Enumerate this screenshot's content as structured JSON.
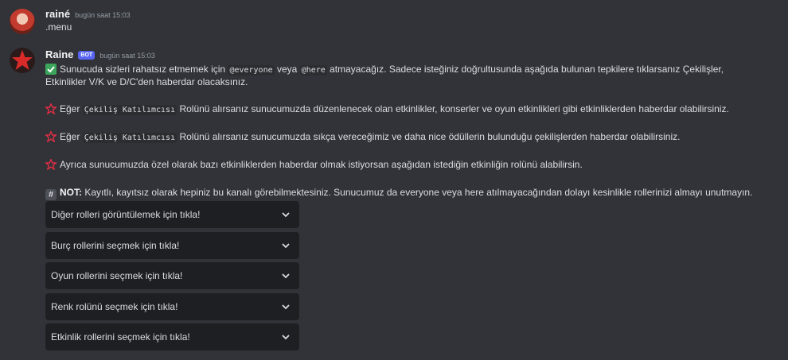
{
  "message1": {
    "author": "rainé",
    "timestamp": "bugün saat 15:03",
    "text": ".menu"
  },
  "message2": {
    "author": "Raine",
    "bot_tag": "BOT",
    "timestamp": "bugün saat 15:03",
    "line1_part1": "Sunucuda sizleri rahatsız etmemek için",
    "everyone": "@everyone",
    "line1_part2": "veya",
    "here": "@here",
    "line1_part3": "atmayacağız. Sadece isteğiniz doğrultusunda aşağıda bulunan tepkilere tıklarsanız Çekilişler,",
    "line2": "Etkinlikler V/K ve D/C'den haberdar olacaksınız.",
    "p1_part1": "Eğer",
    "p1_code": "Çekiliş Katılımcısı",
    "p1_part2": "Rolünü alırsanız sunucumuzda düzenlenecek olan etkinlikler, konserler ve oyun etkinlikleri gibi etkinliklerden haberdar olabilirsiniz.",
    "p2_part1": "Eğer",
    "p2_code": "Çekiliş Katılımcısı",
    "p2_part2": "Rolünü alırsanız sunucumuzda sıkça vereceğimiz  ve daha nice ödüllerin bulunduğu çekilişlerden haberdar olabilirsiniz.",
    "p3": "Ayrıca sunucumuzda özel olarak bazı etkinliklerden haberdar olmak istiyorsan aşağıdan istediğin etkinliğin rolünü alabilirsin.",
    "note_label": "NOT:",
    "note_text": "Kayıtlı, kayıtsız olarak hepiniz bu kanalı görebilmektesiniz. Sunucumuz da everyone veya here atılmayacağından dolayı kesinlikle rollerinizi almayı unutmayın.",
    "select_menus": [
      "Diğer rolleri görüntülemek için tıkla!",
      "Burç rollerini seçmek için tıkla!",
      "Oyun rollerini seçmek için tıkla!",
      "Renk rolünü seçmek için tıkla!",
      "Etkinlik rollerini seçmek için tıkla!"
    ]
  },
  "icons": {
    "check": "check-mark-emoji",
    "star": "red-star-emoji",
    "hash": "hash-emoji",
    "chevron": "chevron-down-icon"
  },
  "colors": {
    "background": "#313338",
    "select_bg": "#1e1f22",
    "bot_tag": "#5865f2",
    "check_green": "#3ba55c",
    "star_red": "#dd2e44"
  }
}
